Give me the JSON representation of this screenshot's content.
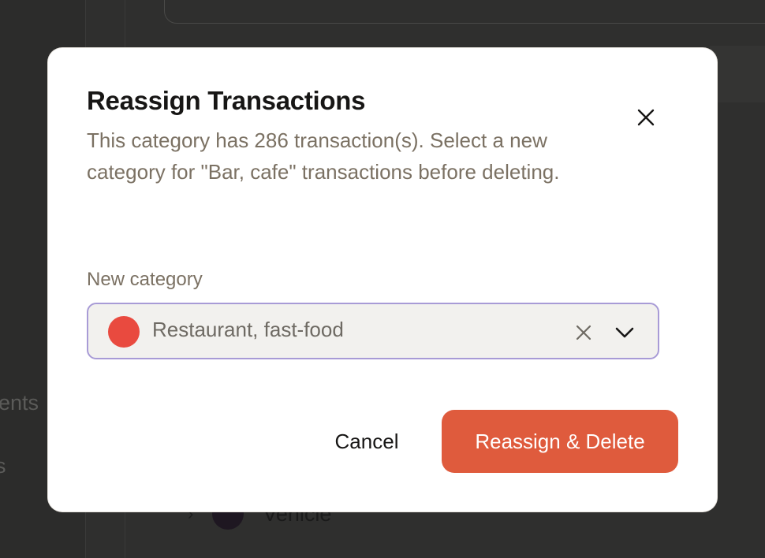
{
  "background": {
    "nav_items": [
      "ents",
      "s"
    ],
    "row_label": "Vehicle",
    "row_dot_color": "#1e1721"
  },
  "dialog": {
    "title": "Reassign Transactions",
    "description": "This category has 286 transaction(s). Select a new category for \"Bar, cafe\" transactions before deleting.",
    "field_label": "New category",
    "selected_category": {
      "label": "Restaurant, fast-food",
      "color": "#e94a3f"
    },
    "cancel_label": "Cancel",
    "confirm_label": "Reassign & Delete",
    "accent_color": "#df5b3d",
    "focus_color": "#a89bd6"
  }
}
